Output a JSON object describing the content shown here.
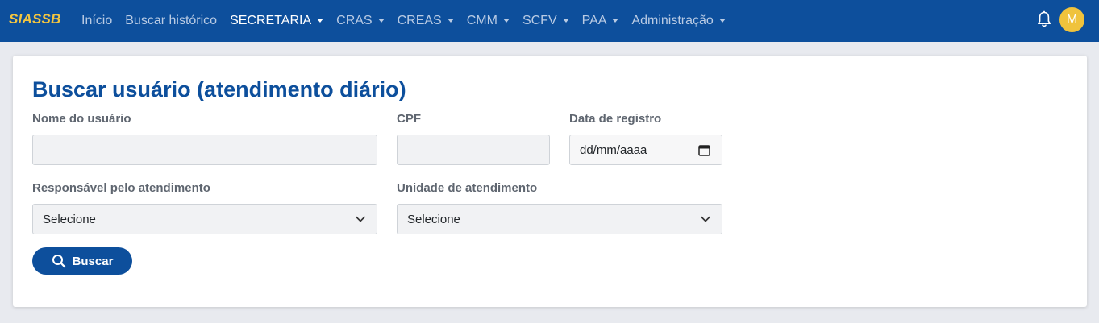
{
  "app": {
    "brand": "SIASSB"
  },
  "nav": {
    "items": [
      {
        "label": "Início",
        "dropdown": false,
        "active": false
      },
      {
        "label": "Buscar histórico",
        "dropdown": false,
        "active": false
      },
      {
        "label": "SECRETARIA",
        "dropdown": true,
        "active": true
      },
      {
        "label": "CRAS",
        "dropdown": true,
        "active": false
      },
      {
        "label": "CREAS",
        "dropdown": true,
        "active": false
      },
      {
        "label": "CMM",
        "dropdown": true,
        "active": false
      },
      {
        "label": "SCFV",
        "dropdown": true,
        "active": false
      },
      {
        "label": "PAA",
        "dropdown": true,
        "active": false
      },
      {
        "label": "Administração",
        "dropdown": true,
        "active": false
      }
    ],
    "avatar_initial": "M",
    "icons": {
      "notifications": "bell-icon"
    }
  },
  "form": {
    "title": "Buscar usuário (atendimento diário)",
    "name_label": "Nome do usuário",
    "name_value": "",
    "cpf_label": "CPF",
    "cpf_value": "",
    "date_label": "Data de registro",
    "date_value": "dd/mm/aaaa",
    "responsible_label": "Responsável pelo atendimento",
    "responsible_value": "Selecione",
    "unit_label": "Unidade de atendimento",
    "unit_value": "Selecione",
    "search_button": "Buscar"
  },
  "colors": {
    "navbar": "#0d4f9c",
    "brand": "#f2c541",
    "avatar": "#f0c33c",
    "title": "#0d4f9c",
    "button": "#0d4f9c"
  }
}
